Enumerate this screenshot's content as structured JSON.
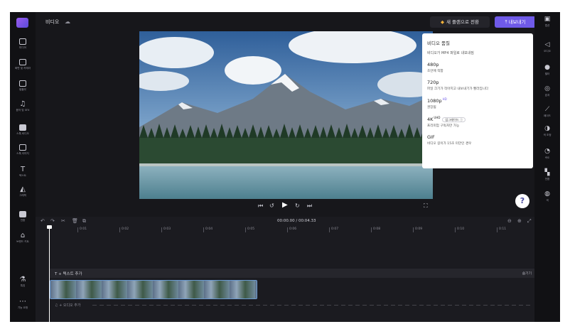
{
  "topbar": {
    "title": "비디오",
    "premium_label": "새 플랜으로 전환",
    "export_label": "내보내기"
  },
  "left_sidebar": {
    "items": [
      {
        "label": "미디어",
        "icon": "folder-icon"
      },
      {
        "label": "화면 및 카메라",
        "icon": "record-icon"
      },
      {
        "label": "템플릿",
        "icon": "templates-icon"
      },
      {
        "label": "음악 및 SFX",
        "icon": "music-icon"
      },
      {
        "label": "스톡 비디오",
        "icon": "stock-video-icon"
      },
      {
        "label": "스톡 이미지",
        "icon": "stock-image-icon"
      },
      {
        "label": "텍스트",
        "icon": "text-icon"
      },
      {
        "label": "그래픽",
        "icon": "graphics-icon"
      },
      {
        "label": "전환",
        "icon": "transitions-icon"
      },
      {
        "label": "브랜드 키트",
        "icon": "brand-kit-icon"
      },
      {
        "label": "특징",
        "icon": "features-icon"
      },
      {
        "label": "기능 요청",
        "icon": "feature-request-icon"
      }
    ]
  },
  "right_sidebar": {
    "items": [
      {
        "label": "캡션",
        "icon": "captions-icon"
      },
      {
        "label": "오디오",
        "icon": "audio-icon"
      },
      {
        "label": "필터",
        "icon": "filters-icon"
      },
      {
        "label": "효과",
        "icon": "effects-icon"
      },
      {
        "label": "페이드",
        "icon": "fade-icon"
      },
      {
        "label": "색 조정",
        "icon": "color-icon"
      },
      {
        "label": "속도",
        "icon": "speed-icon"
      },
      {
        "label": "전환",
        "icon": "transition-icon"
      },
      {
        "label": "색",
        "icon": "palette-icon"
      }
    ]
  },
  "export_panel": {
    "title": "비디오 품질",
    "subtitle": "비디오가 MP4 파일로 내보내짐",
    "options": [
      {
        "res": "480p",
        "desc": "초안에 적합"
      },
      {
        "res": "720p",
        "desc": "파일 크기가 작아지고 내보내기가 빨라집니다",
        "tag": ""
      },
      {
        "res": "1080p",
        "desc": "권장됨",
        "tag": "HD"
      },
      {
        "res": "4K",
        "desc": "프리미엄 구독자만 가능",
        "tag": "UHD",
        "badge": "업그레이드"
      },
      {
        "res": "GIF",
        "desc": "비디오 길이가 15초 미만인 경우"
      }
    ]
  },
  "help_label": "?",
  "timeline": {
    "timecode": "00:00.00 / 00:04.33",
    "ruler": [
      "0:01",
      "0:02",
      "0:03",
      "0:04",
      "0:05",
      "0:06",
      "0:07",
      "0:08",
      "0:09",
      "0:10",
      "0:11"
    ],
    "text_track_label": "T  + 텍스트 추가",
    "text_track_hide": "숨기기",
    "audio_track_label": "♫  + 오디오 추가"
  }
}
